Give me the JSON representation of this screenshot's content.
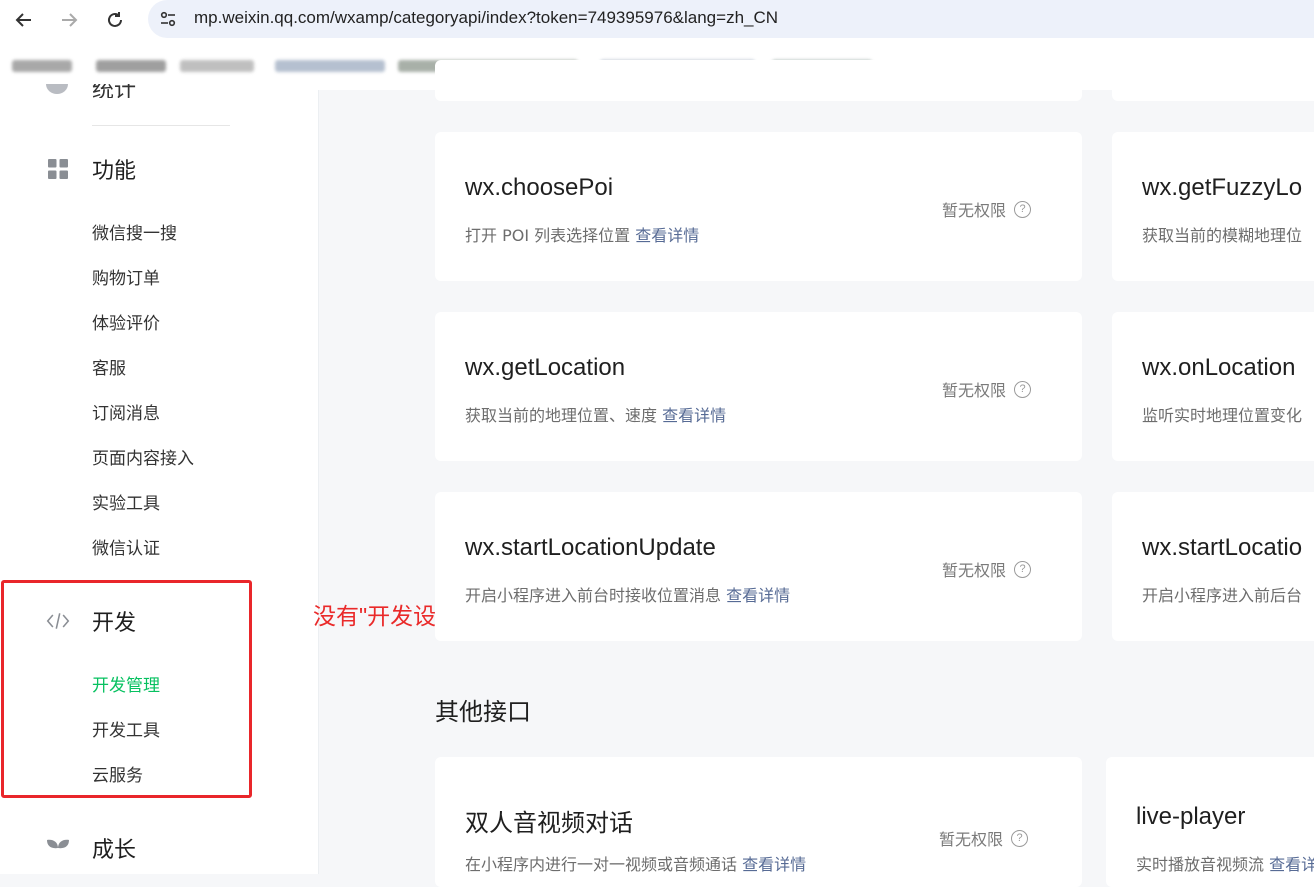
{
  "browser": {
    "url": "mp.weixin.qq.com/wxamp/categoryapi/index?token=749395976&lang=zh_CN"
  },
  "sidebar": {
    "cut_label": "统计",
    "groups": [
      {
        "title": "功能",
        "icon": "grid-icon",
        "items": [
          "微信搜一搜",
          "购物订单",
          "体验评价",
          "客服",
          "订阅消息",
          "页面内容接入",
          "实验工具",
          "微信认证"
        ]
      },
      {
        "title": "开发",
        "icon": "code-icon",
        "items": [
          "开发管理",
          "开发工具",
          "云服务"
        ],
        "active_item": "开发管理"
      },
      {
        "title": "成长",
        "icon": "sprout-icon"
      }
    ]
  },
  "annotation": "没有\"开发设置\"",
  "main": {
    "permission_label": "暂无权限",
    "detail_link": "查看详情",
    "cards": [
      {
        "title": "wx.choosePoi",
        "desc": "打开 POI 列表选择位置"
      },
      {
        "title": "wx.getFuzzyLo",
        "desc": "获取当前的模糊地理位"
      },
      {
        "title": "wx.getLocation",
        "desc": "获取当前的地理位置、速度"
      },
      {
        "title": "wx.onLocation",
        "desc": "监听实时地理位置变化"
      },
      {
        "title": "wx.startLocationUpdate",
        "desc": "开启小程序进入前台时接收位置消息"
      },
      {
        "title": "wx.startLocatio",
        "desc": "开启小程序进入前后台"
      }
    ],
    "other_section_title": "其他接口",
    "other_cards": [
      {
        "title": "双人音视频对话",
        "desc": "在小程序内进行一对一视频或音频通话"
      },
      {
        "title": "live-player",
        "desc": "实时播放音视频流"
      }
    ]
  }
}
